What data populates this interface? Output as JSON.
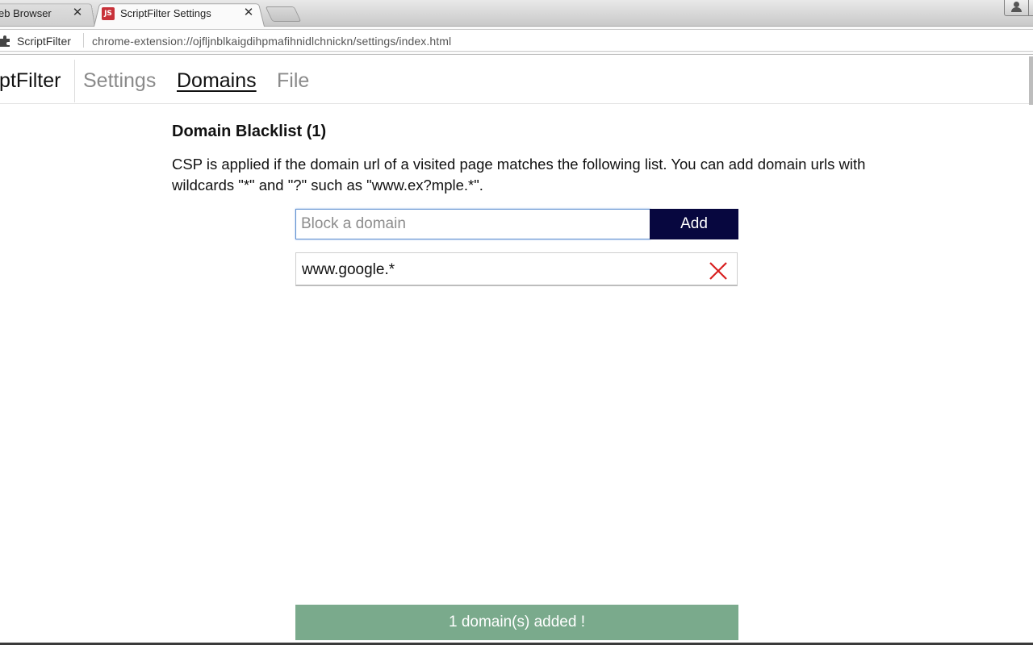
{
  "browser": {
    "tabs": [
      {
        "title": "eb Browser",
        "active": false,
        "close": "✕"
      },
      {
        "title": "ScriptFilter Settings",
        "active": true,
        "close": "✕",
        "favicon_text": "JS"
      }
    ],
    "omnibox": {
      "extension_name": "ScriptFilter",
      "url": "chrome-extension://ojfljnblkaigdihpmafihnidlchnickn/settings/index.html"
    }
  },
  "app": {
    "brand": "ScriptFilter",
    "nav": [
      {
        "label": "Settings",
        "active": false
      },
      {
        "label": "Domains",
        "active": true
      },
      {
        "label": "File",
        "active": false
      }
    ]
  },
  "domains": {
    "heading": "Domain Blacklist (1)",
    "description": "CSP is applied if the domain url of a visited page matches the following list. You can add domain urls with wildcards \"*\" and \"?\" such as \"www.ex?mple.*\".",
    "input_placeholder": "Block a domain",
    "input_value": "",
    "add_label": "Add",
    "list": [
      {
        "value": "www.google.*"
      }
    ]
  },
  "toast": {
    "message": "1 domain(s) added !"
  },
  "colors": {
    "add_button": "#07073f",
    "toast": "#7aaa8c",
    "remove_icon": "#d81e1e",
    "input_focus_border": "#5f8fd0"
  }
}
